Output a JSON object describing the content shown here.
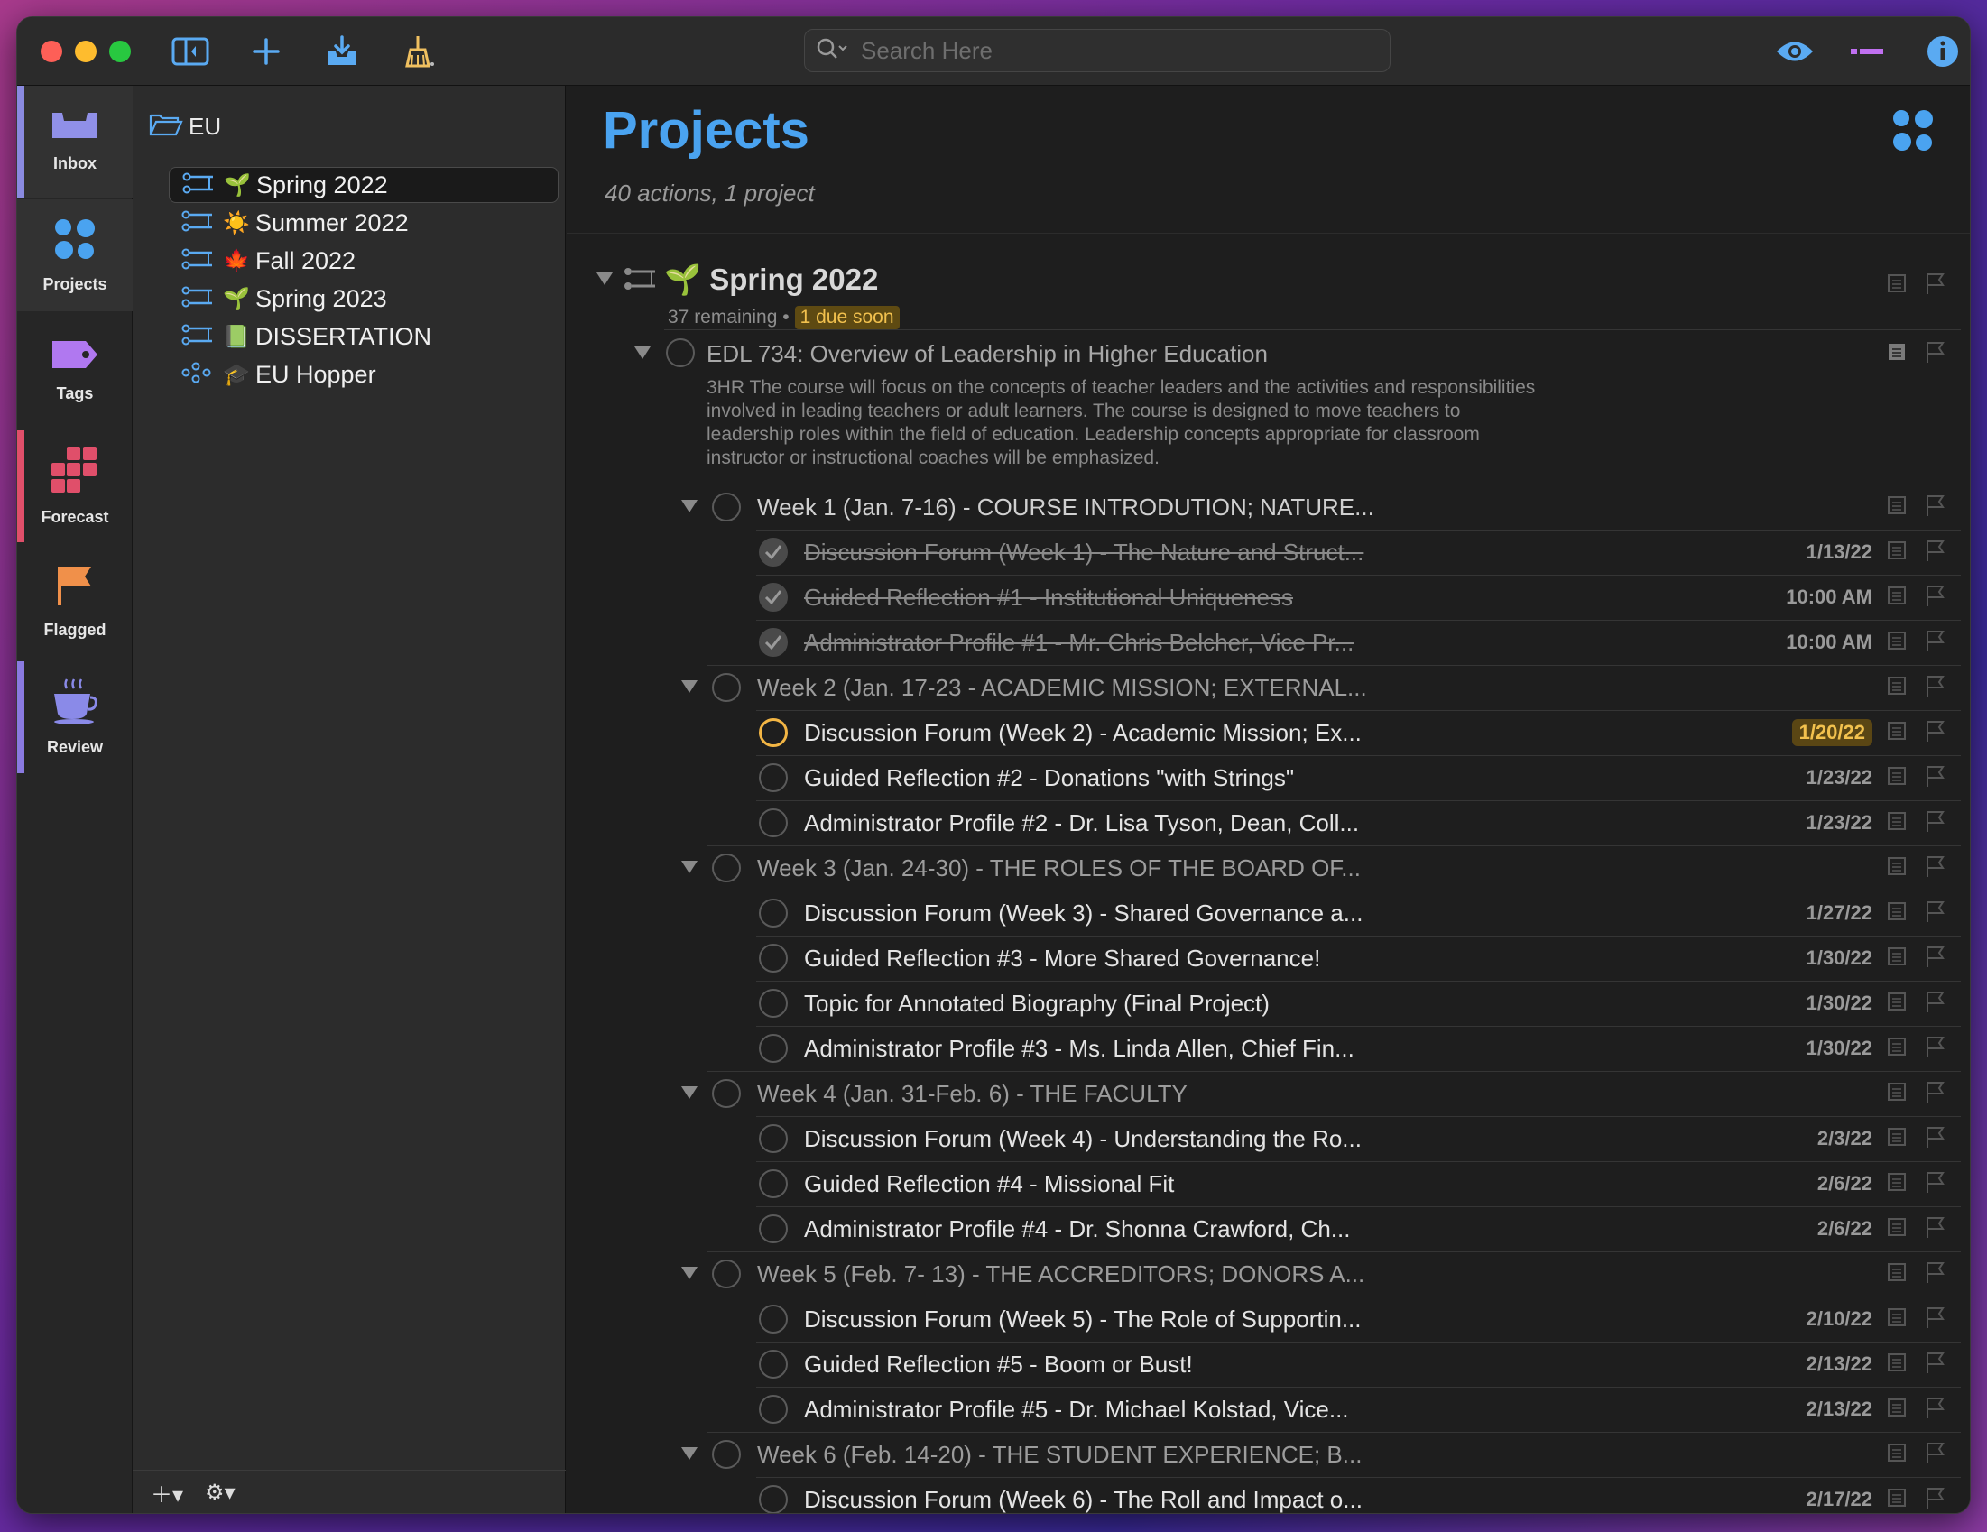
{
  "toolbar": {
    "search_placeholder": "Search Here"
  },
  "nav": {
    "items": [
      {
        "label": "Inbox"
      },
      {
        "label": "Projects"
      },
      {
        "label": "Tags"
      },
      {
        "label": "Forecast"
      },
      {
        "label": "Flagged"
      },
      {
        "label": "Review"
      }
    ]
  },
  "sidebar": {
    "folder": "EU",
    "projects": [
      {
        "emoji": "🌱",
        "label": "Spring 2022"
      },
      {
        "emoji": "☀️",
        "label": "Summer 2022"
      },
      {
        "emoji": "🍁",
        "label": "Fall 2022"
      },
      {
        "emoji": "🌱",
        "label": "Spring 2023"
      },
      {
        "emoji": "📗",
        "label": "DISSERTATION"
      },
      {
        "emoji": "🎓",
        "label": "EU Hopper"
      }
    ]
  },
  "main": {
    "title": "Projects",
    "subtitle": "40 actions, 1 project",
    "project": {
      "emoji": "🌱",
      "title": "Spring 2022",
      "remaining": "37 remaining •",
      "due_soon": "1 due soon"
    },
    "course": {
      "title": "EDL 734: Overview of Leadership in Higher Education",
      "note": "3HR  The course will focus on the concepts of teacher leaders and the activities and responsibilities involved in leading teachers or adult learners. The course is designed to move teachers to leadership roles within the field of education. Leadership concepts appropriate for classroom instructor or instructional coaches will be emphasized."
    },
    "rows": [
      {
        "title": "Week 1 (Jan. 7-16) - COURSE INTRODUTION; NATURE...",
        "date": ""
      },
      {
        "title": "Discussion Forum (Week 1) - The Nature and Struct...",
        "date": "1/13/22"
      },
      {
        "title": "Guided Reflection #1 - Institutional Uniqueness",
        "date": "10:00 AM"
      },
      {
        "title": "Administrator Profile #1 - Mr. Chris Belcher, Vice Pr...",
        "date": "10:00 AM"
      },
      {
        "title": "Week 2 (Jan. 17-23 - ACADEMIC MISSION; EXTERNAL...",
        "date": ""
      },
      {
        "title": "Discussion Forum (Week 2) - Academic Mission; Ex...",
        "date": "1/20/22"
      },
      {
        "title": "Guided Reflection #2 - Donations \"with Strings\"",
        "date": "1/23/22"
      },
      {
        "title": "Administrator Profile #2 - Dr. Lisa Tyson, Dean, Coll...",
        "date": "1/23/22"
      },
      {
        "title": "Week 3 (Jan. 24-30) - THE ROLES OF THE BOARD OF...",
        "date": ""
      },
      {
        "title": "Discussion Forum (Week 3) - Shared Governance a...",
        "date": "1/27/22"
      },
      {
        "title": "Guided Reflection #3 - More Shared Governance!",
        "date": "1/30/22"
      },
      {
        "title": "Topic for Annotated Biography (Final Project)",
        "date": "1/30/22"
      },
      {
        "title": "Administrator Profile #3 - Ms. Linda Allen, Chief Fin...",
        "date": "1/30/22"
      },
      {
        "title": "Week 4 (Jan. 31-Feb. 6) - THE FACULTY",
        "date": ""
      },
      {
        "title": "Discussion Forum (Week 4) - Understanding the Ro...",
        "date": "2/3/22"
      },
      {
        "title": "Guided Reflection #4 - Missional Fit",
        "date": "2/6/22"
      },
      {
        "title": "Administrator Profile #4 - Dr. Shonna Crawford, Ch...",
        "date": "2/6/22"
      },
      {
        "title": "Week 5 (Feb. 7- 13) - THE ACCREDITORS; DONORS A...",
        "date": ""
      },
      {
        "title": "Discussion Forum (Week 5) - The Role of Supportin...",
        "date": "2/10/22"
      },
      {
        "title": "Guided Reflection #5 - Boom or Bust!",
        "date": "2/13/22"
      },
      {
        "title": "Administrator Profile #5 - Dr. Michael Kolstad, Vice...",
        "date": "2/13/22"
      },
      {
        "title": "Week 6 (Feb. 14-20) - THE STUDENT EXPERIENCE; B...",
        "date": ""
      },
      {
        "title": "Discussion Forum (Week 6) - The Roll and Impact o...",
        "date": "2/17/22"
      }
    ]
  },
  "colors": {
    "accent_blue": "#4aa3f0",
    "due_yellow": "#f2c14e",
    "inbox_bar": "#8a8ae0",
    "forecast_bar": "#e04f6a",
    "review_bar": "#8a7ae0"
  }
}
